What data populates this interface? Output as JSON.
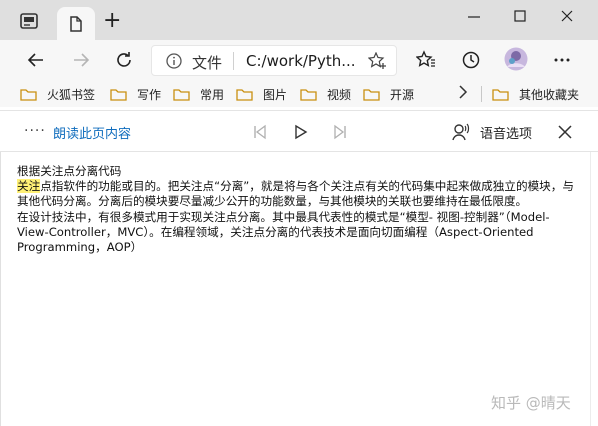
{
  "browser": {
    "address": {
      "scheme_label": "文件",
      "url": "C:/work/Pyth..."
    },
    "bookmarks": [
      {
        "label": "火狐书签"
      },
      {
        "label": "写作"
      },
      {
        "label": "常用"
      },
      {
        "label": "图片"
      },
      {
        "label": "视频"
      },
      {
        "label": "开源"
      }
    ],
    "bookmarks_overflow": {
      "label": "其他收藏夹"
    }
  },
  "reader": {
    "read_aloud_label": "朗读此页内容",
    "voice_options_label": "语音选项"
  },
  "page": {
    "heading": "根据关注点分离代码",
    "para1_highlight": "关注",
    "para1_rest": "点指软件的功能或目的。把关注点“分离”，就是将与各个关注点有关的代码集中起来做成独立的模块，与其他代码分离。分离后的模块要尽量减少公开的功能数量，与其他模块的关联也要维持在最低限度。",
    "para2": "在设计技法中，有很多模式用于实现关注点分离。其中最具代表性的模式是“模型- 视图-控制器”（Model-View-Controller，MVC）。在编程领域，关注点分离的代表技术是面向切面编程（Aspect-Oriented Programming，AOP）"
  },
  "watermark": "知乎 @晴天",
  "colors": {
    "tabbar_bg": "#dfdfdf",
    "toolbar_bg": "#f7f7f7",
    "accent_blue": "#0f6cbd",
    "highlight": "#fff176",
    "folder_yellow": "#f4c44e"
  }
}
